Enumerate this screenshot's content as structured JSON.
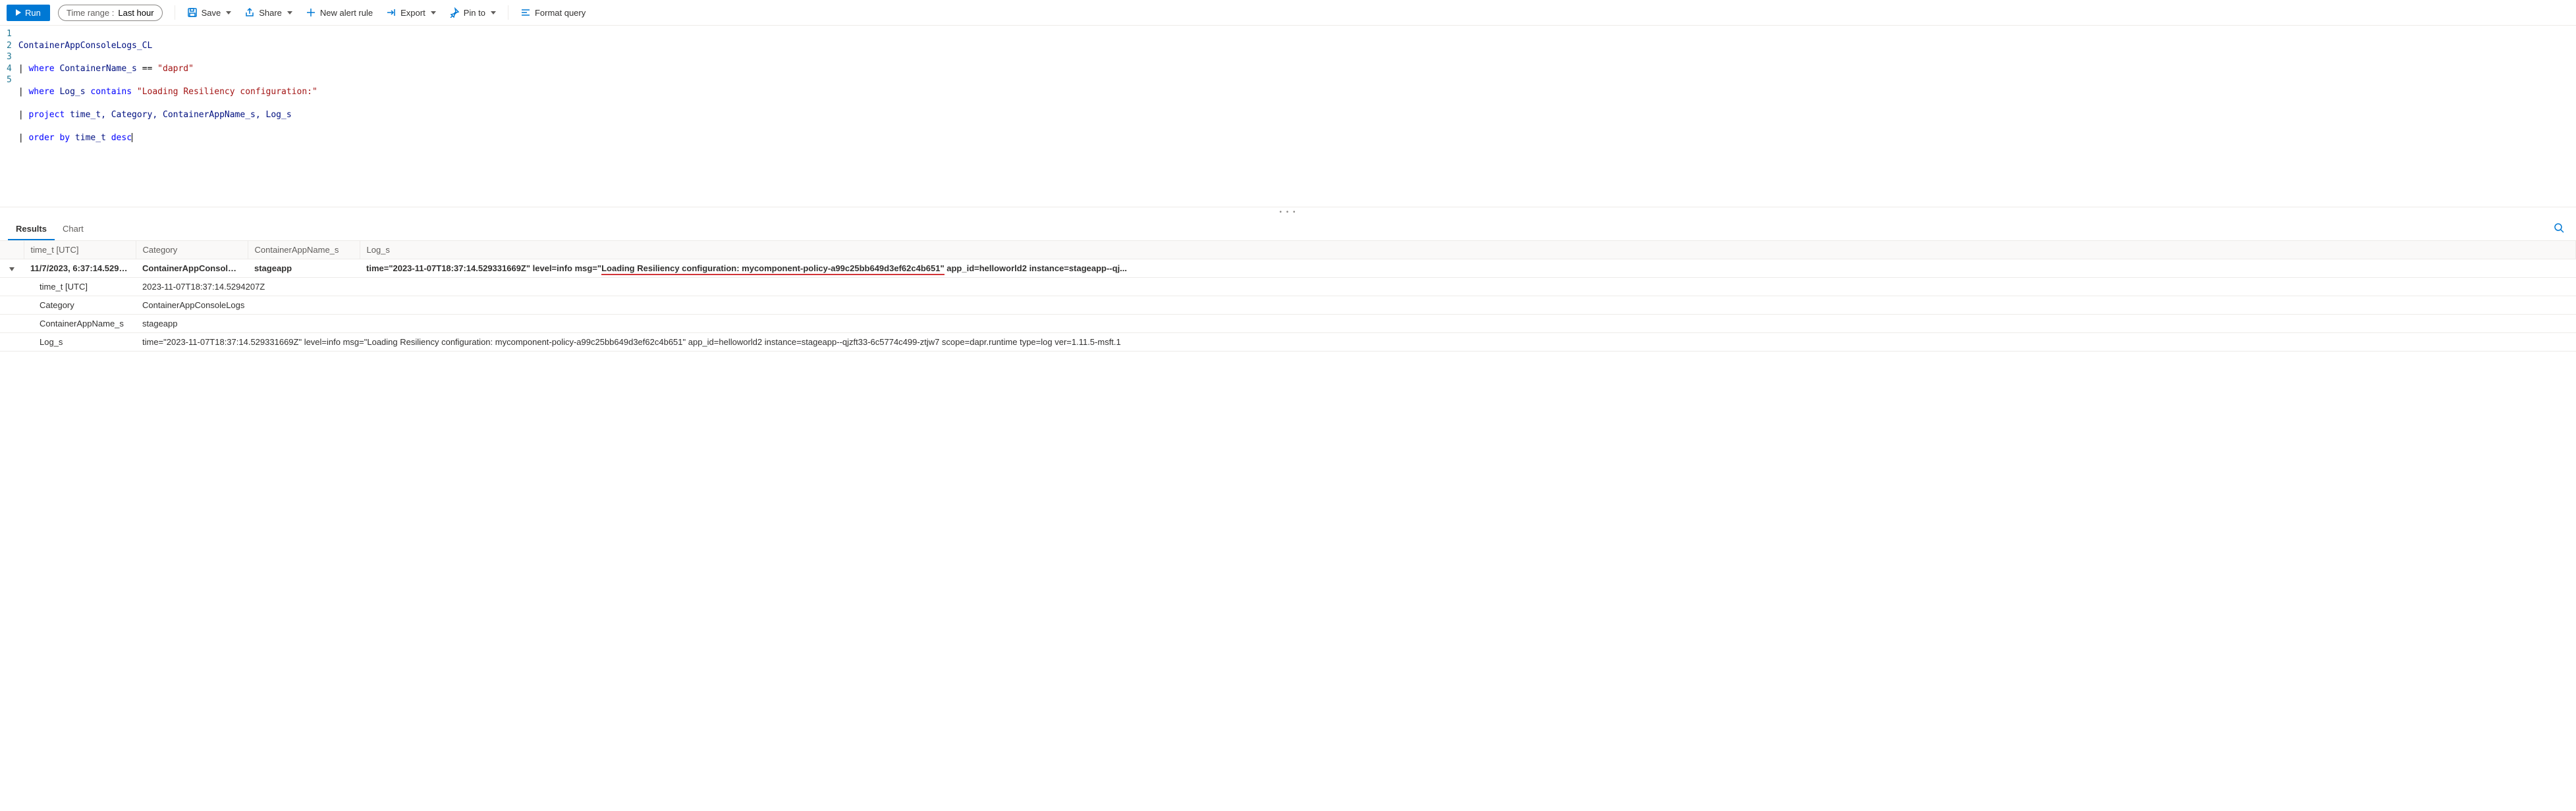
{
  "toolbar": {
    "run_label": "Run",
    "time_range_label": "Time range :",
    "time_range_value": "Last hour",
    "save_label": "Save",
    "share_label": "Share",
    "new_alert_label": "New alert rule",
    "export_label": "Export",
    "pin_to_label": "Pin to",
    "format_query_label": "Format query"
  },
  "query": {
    "lines": [
      "1",
      "2",
      "3",
      "4",
      "5"
    ],
    "l1_table": "ContainerAppConsoleLogs_CL",
    "l2_pipe": "| ",
    "l2_kw": "where",
    "l2_ident": " ContainerName_s ",
    "l2_op": "== ",
    "l2_str": "\"daprd\"",
    "l3_pipe": "| ",
    "l3_kw": "where",
    "l3_ident": " Log_s ",
    "l3_kw2": "contains",
    "l3_str": " \"Loading Resiliency configuration:\"",
    "l4_pipe": "| ",
    "l4_kw": "project",
    "l4_rest": " time_t, Category, ContainerAppName_s, Log_s",
    "l5_pipe": "| ",
    "l5_kw": "order by",
    "l5_ident": " time_t ",
    "l5_kw2": "desc"
  },
  "tabs": {
    "results": "Results",
    "chart": "Chart"
  },
  "columns": {
    "c1": "time_t [UTC]",
    "c2": "Category",
    "c3": "ContainerAppName_s",
    "c4": "Log_s"
  },
  "row": {
    "time_display": "11/7/2023, 6:37:14.529 PM",
    "category": "ContainerAppConsoleLogs",
    "app": "stageapp",
    "log_prefix": "time=\"2023-11-07T18:37:14.529331669Z\" level=info msg=\"",
    "log_highlight": "Loading Resiliency configuration: mycomponent-policy-a99c25bb649d3ef62c4b651\"",
    "log_suffix1": " app_id=helloworld2 instance=stageapp--qj...",
    "detail_time_k": "time_t [UTC]",
    "detail_time_v": "2023-11-07T18:37:14.5294207Z",
    "detail_cat_k": "Category",
    "detail_cat_v": "ContainerAppConsoleLogs",
    "detail_app_k": "ContainerAppName_s",
    "detail_app_v": "stageapp",
    "detail_log_k": "Log_s",
    "detail_log_v": "time=\"2023-11-07T18:37:14.529331669Z\" level=info msg=\"Loading Resiliency configuration: mycomponent-policy-a99c25bb649d3ef62c4b651\" app_id=helloworld2 instance=stageapp--qjzft33-6c5774c499-ztjw7 scope=dapr.runtime type=log ver=1.11.5-msft.1"
  }
}
